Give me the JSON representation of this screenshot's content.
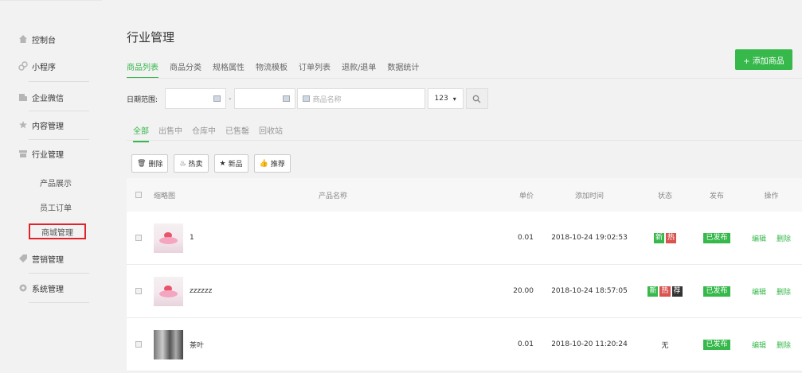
{
  "sidebar": {
    "items": [
      {
        "label": "控制台",
        "icon": "home-icon"
      },
      {
        "label": "小程序",
        "icon": "link-icon"
      },
      {
        "label": "企业微信",
        "icon": "building-icon"
      },
      {
        "label": "内容管理",
        "icon": "star-icon"
      },
      {
        "label": "行业管理",
        "icon": "store-icon"
      },
      {
        "label": "营销管理",
        "icon": "tag-icon"
      },
      {
        "label": "系统管理",
        "icon": "gear-icon"
      }
    ],
    "sub_items": [
      "产品展示",
      "员工订单",
      "商城管理"
    ]
  },
  "page": {
    "title": "行业管理",
    "tabs": [
      "商品列表",
      "商品分类",
      "规格属性",
      "物流模板",
      "订单列表",
      "退款/退单",
      "数据统计"
    ],
    "add_button": "+ 添加商品"
  },
  "filter": {
    "date_label": "日期范围:",
    "dash": "-",
    "name_placeholder": "商品名称",
    "select_value": "123"
  },
  "subtabs": [
    "全部",
    "出售中",
    "仓库中",
    "已售罄",
    "回收站"
  ],
  "actions": [
    {
      "label": "删除",
      "icon": "trash-icon",
      "glyph": "🗑"
    },
    {
      "label": "热卖",
      "icon": "fire-icon",
      "glyph": "♨"
    },
    {
      "label": "新品",
      "icon": "star-icon",
      "glyph": "★"
    },
    {
      "label": "推荐",
      "icon": "thumb-up-icon",
      "glyph": "👍"
    }
  ],
  "table": {
    "headers": {
      "thumb": "缩略图",
      "name": "产品名称",
      "price": "单价",
      "time": "添加时间",
      "status": "状态",
      "publish": "发布",
      "ops": "操作"
    },
    "rows": [
      {
        "name": "1",
        "price": "0.01",
        "time": "2018-10-24 19:02:53",
        "status": [
          "新",
          "热"
        ],
        "status_text": "",
        "publish": "已发布",
        "edit": "编辑",
        "delete": "删除",
        "thumb": "cake"
      },
      {
        "name": "zzzzzz",
        "price": "20.00",
        "time": "2018-10-24 18:57:05",
        "status": [
          "新",
          "热",
          "荐"
        ],
        "status_text": "",
        "publish": "已发布",
        "edit": "编辑",
        "delete": "删除",
        "thumb": "cake"
      },
      {
        "name": "茶叶",
        "price": "0.01",
        "time": "2018-10-20 11:20:24",
        "status": [],
        "status_text": "无",
        "publish": "已发布",
        "edit": "编辑",
        "delete": "删除",
        "thumb": "tea"
      }
    ]
  },
  "colors": {
    "accent": "#36b84b",
    "danger": "#d9534f",
    "highlight_border": "#e0242a"
  }
}
